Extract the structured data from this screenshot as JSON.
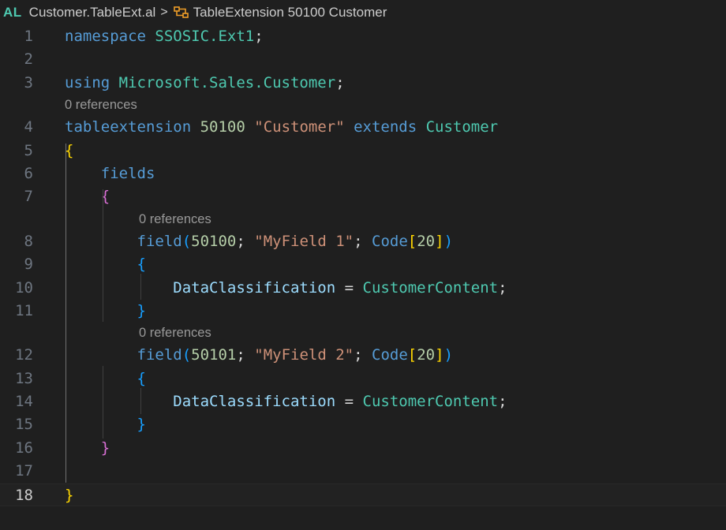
{
  "breadcrumb": {
    "lang": "AL",
    "file": "Customer.TableExt.al",
    "separator": ">",
    "symbol": "TableExtension 50100 Customer",
    "symbol_icon": "symbol-class-icon"
  },
  "lines": [
    {
      "n": "1",
      "tokens": [
        {
          "t": "namespace ",
          "c": "kw"
        },
        {
          "t": "SSOSIC.Ext1",
          "c": "ns"
        },
        {
          "t": ";",
          "c": "pl"
        }
      ]
    },
    {
      "n": "2",
      "tokens": []
    },
    {
      "n": "3",
      "tokens": [
        {
          "t": "using ",
          "c": "kw"
        },
        {
          "t": "Microsoft.Sales.Customer",
          "c": "ns"
        },
        {
          "t": ";",
          "c": "pl"
        }
      ]
    },
    {
      "lens": "0 references",
      "indent": 0
    },
    {
      "n": "4",
      "tokens": [
        {
          "t": "tableextension ",
          "c": "kw"
        },
        {
          "t": "50100",
          "c": "num"
        },
        {
          "t": " ",
          "c": "pl"
        },
        {
          "t": "\"Customer\"",
          "c": "str"
        },
        {
          "t": " extends ",
          "c": "kw"
        },
        {
          "t": "Customer",
          "c": "ns"
        }
      ]
    },
    {
      "n": "5",
      "tokens": [
        {
          "t": "{",
          "c": "b1"
        }
      ]
    },
    {
      "n": "6",
      "tokens": [
        {
          "t": "    ",
          "c": "pl"
        },
        {
          "t": "fields",
          "c": "kw"
        }
      ]
    },
    {
      "n": "7",
      "tokens": [
        {
          "t": "    ",
          "c": "pl"
        },
        {
          "t": "{",
          "c": "b2"
        }
      ]
    },
    {
      "lens": "0 references",
      "indent": 8
    },
    {
      "n": "8",
      "tokens": [
        {
          "t": "        ",
          "c": "pl"
        },
        {
          "t": "field",
          "c": "kw"
        },
        {
          "t": "(",
          "c": "b3"
        },
        {
          "t": "50100",
          "c": "num"
        },
        {
          "t": "; ",
          "c": "pl"
        },
        {
          "t": "\"MyField 1\"",
          "c": "str"
        },
        {
          "t": "; ",
          "c": "pl"
        },
        {
          "t": "Code",
          "c": "kw"
        },
        {
          "t": "[",
          "c": "b1"
        },
        {
          "t": "20",
          "c": "num"
        },
        {
          "t": "]",
          "c": "b1"
        },
        {
          "t": ")",
          "c": "b3"
        }
      ]
    },
    {
      "n": "9",
      "tokens": [
        {
          "t": "        ",
          "c": "pl"
        },
        {
          "t": "{",
          "c": "b3"
        }
      ]
    },
    {
      "n": "10",
      "tokens": [
        {
          "t": "            ",
          "c": "pl"
        },
        {
          "t": "DataClassification",
          "c": "prop"
        },
        {
          "t": " = ",
          "c": "pl"
        },
        {
          "t": "CustomerContent",
          "c": "ns"
        },
        {
          "t": ";",
          "c": "pl"
        }
      ]
    },
    {
      "n": "11",
      "tokens": [
        {
          "t": "        ",
          "c": "pl"
        },
        {
          "t": "}",
          "c": "b3"
        }
      ]
    },
    {
      "lens": "0 references",
      "indent": 8
    },
    {
      "n": "12",
      "tokens": [
        {
          "t": "        ",
          "c": "pl"
        },
        {
          "t": "field",
          "c": "kw"
        },
        {
          "t": "(",
          "c": "b3"
        },
        {
          "t": "50101",
          "c": "num"
        },
        {
          "t": "; ",
          "c": "pl"
        },
        {
          "t": "\"MyField 2\"",
          "c": "str"
        },
        {
          "t": "; ",
          "c": "pl"
        },
        {
          "t": "Code",
          "c": "kw"
        },
        {
          "t": "[",
          "c": "b1"
        },
        {
          "t": "20",
          "c": "num"
        },
        {
          "t": "]",
          "c": "b1"
        },
        {
          "t": ")",
          "c": "b3"
        }
      ]
    },
    {
      "n": "13",
      "tokens": [
        {
          "t": "        ",
          "c": "pl"
        },
        {
          "t": "{",
          "c": "b3"
        }
      ]
    },
    {
      "n": "14",
      "tokens": [
        {
          "t": "            ",
          "c": "pl"
        },
        {
          "t": "DataClassification",
          "c": "prop"
        },
        {
          "t": " = ",
          "c": "pl"
        },
        {
          "t": "CustomerContent",
          "c": "ns"
        },
        {
          "t": ";",
          "c": "pl"
        }
      ]
    },
    {
      "n": "15",
      "tokens": [
        {
          "t": "        ",
          "c": "pl"
        },
        {
          "t": "}",
          "c": "b3"
        }
      ]
    },
    {
      "n": "16",
      "tokens": [
        {
          "t": "    ",
          "c": "pl"
        },
        {
          "t": "}",
          "c": "b2"
        }
      ]
    },
    {
      "n": "17",
      "tokens": []
    },
    {
      "n": "18",
      "tokens": [
        {
          "t": "}",
          "c": "b1"
        }
      ],
      "current": true
    }
  ]
}
